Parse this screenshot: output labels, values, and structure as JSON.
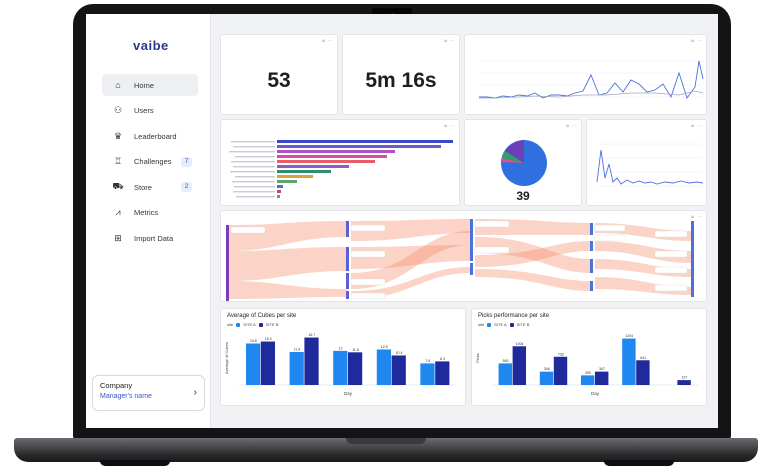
{
  "app": {
    "brand": "vaibe"
  },
  "sidebar": {
    "items": [
      {
        "label": "Home",
        "icon": "home-icon",
        "active": true
      },
      {
        "label": "Users",
        "icon": "users-icon"
      },
      {
        "label": "Leaderboard",
        "icon": "crown-icon"
      },
      {
        "label": "Challenges",
        "icon": "trophy-icon",
        "badge": "7"
      },
      {
        "label": "Store",
        "icon": "cart-icon",
        "badge": "2"
      },
      {
        "label": "Metrics",
        "icon": "metrics-icon"
      },
      {
        "label": "Import Data",
        "icon": "table-icon"
      }
    ],
    "company": {
      "name": "Company",
      "manager": "Manager's name"
    }
  },
  "cards": {
    "logins": {
      "value": "53"
    },
    "avg_time": {
      "value": "5m 16s"
    },
    "donut": {
      "value": "39"
    }
  },
  "colors": {
    "accent": "#3d52c9",
    "brand": "#2b3a8c",
    "site_a": "#1e88f0",
    "site_b": "#1f2a9c",
    "sankey": "#f4845f"
  },
  "chart_data": [
    {
      "type": "bar",
      "title": "Average of Cubes per site",
      "xlabel": "Day",
      "ylabel": "Average of Cubes",
      "legend_prefix": "site",
      "categories": [
        "",
        "",
        "",
        "",
        ""
      ],
      "series": [
        {
          "name": "SITE A",
          "values": [
            14.6,
            11.6,
            12.0,
            12.5,
            7.6
          ]
        },
        {
          "name": "SITE B",
          "values": [
            15.3,
            16.7,
            11.5,
            10.4,
            8.3
          ]
        }
      ],
      "ylim": [
        0,
        19
      ]
    },
    {
      "type": "bar",
      "title": "Picks performance per site",
      "xlabel": "Day",
      "ylabel": "Picks",
      "legend_prefix": "site",
      "categories": [
        "",
        "",
        "",
        "",
        ""
      ],
      "series": [
        {
          "name": "SITE A",
          "values": [
            560,
            346,
            250,
            1204,
            0
          ]
        },
        {
          "name": "SITE B",
          "values": [
            1004,
            732,
            347,
            641,
            127
          ]
        }
      ],
      "ylim": [
        0,
        1400
      ]
    }
  ]
}
